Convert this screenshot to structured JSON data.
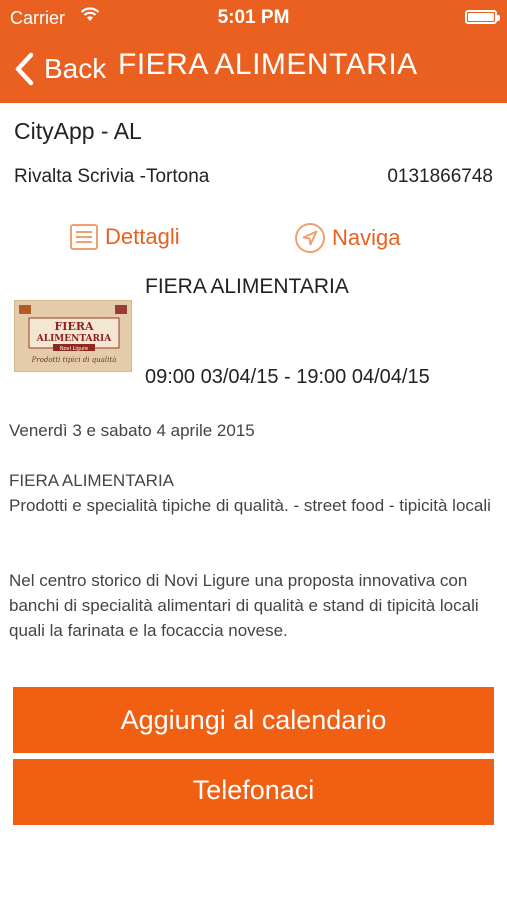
{
  "status_bar": {
    "carrier": "Carrier",
    "time": "5:01 PM"
  },
  "nav": {
    "back_label": "Back",
    "title": "FIERA ALIMENTARIA"
  },
  "place": {
    "name": "CityApp - AL",
    "address": "Rivalta Scrivia -Tortona",
    "phone": "0131866748"
  },
  "actions": {
    "details_label": "Dettagli",
    "navigate_label": "Naviga"
  },
  "event": {
    "title": "FIERA ALIMENTARIA",
    "datetime": "09:00 03/04/15 - 19:00 04/04/15",
    "image": {
      "line1": "FIERA",
      "line2": "ALIMENTARIA",
      "line3": "Novi Ligure",
      "line4": "Prodotti tipici di qualità"
    },
    "date_text": "Venerdì 3 e sabato 4 aprile 2015",
    "description_title": "FIERA ALIMENTARIA",
    "description_subtitle": "Prodotti e specialità tipiche di qualità. - street  food - tipicità locali",
    "description_body": "Nel centro storico di Novi Ligure una proposta innovativa con  banchi di specialità alimentari di qualità e stand di tipicità locali quali la farinata e la focaccia novese."
  },
  "buttons": {
    "calendar_label": "Aggiungi al calendario",
    "call_label": "Telefonaci"
  },
  "colors": {
    "accent": "#ea6020",
    "button": "#f15f13"
  }
}
